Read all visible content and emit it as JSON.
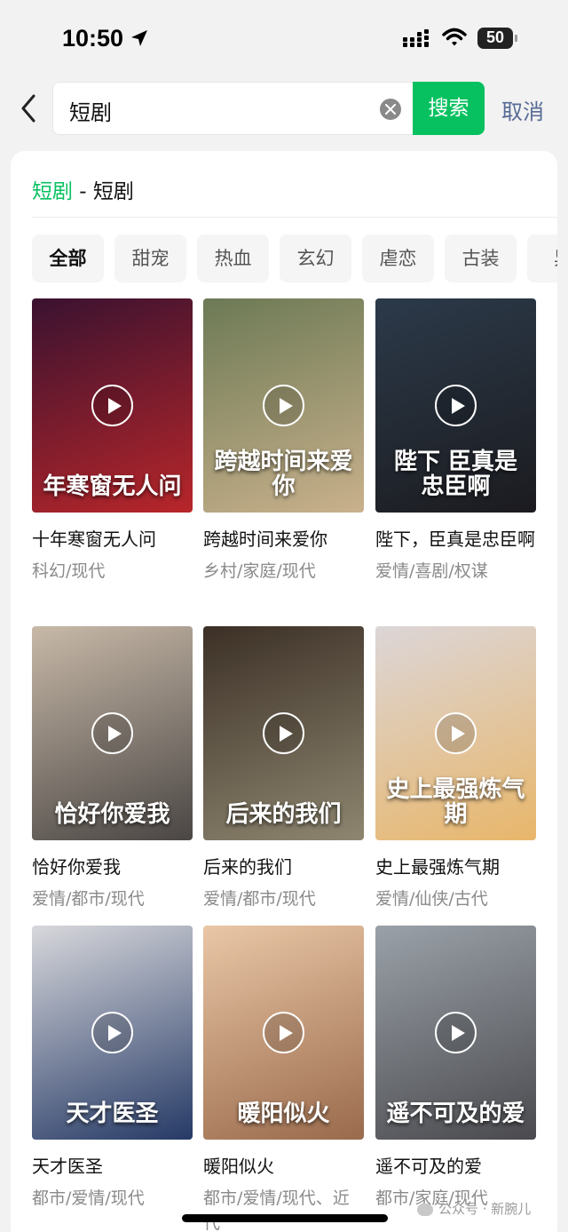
{
  "status_bar": {
    "time": "10:50",
    "battery": "50"
  },
  "search": {
    "query": "短剧",
    "button_label": "搜索",
    "cancel_label": "取消"
  },
  "result_header": {
    "highlight": "短剧",
    "rest": " - 短剧"
  },
  "tabs": [
    {
      "label": "全部",
      "active": true
    },
    {
      "label": "甜宠"
    },
    {
      "label": "热血"
    },
    {
      "label": "玄幻"
    },
    {
      "label": "虐恋"
    },
    {
      "label": "古装"
    },
    {
      "label": "异"
    }
  ],
  "dramas": [
    {
      "title": "十年寒窗无人问",
      "tags": "科幻/现代",
      "poster_text": "年寒窗无人问",
      "colors": [
        "#3a1230",
        "#b8262a"
      ]
    },
    {
      "title": "跨越时间来爱你",
      "tags": "乡村/家庭/现代",
      "poster_text": "跨越时间来爱你",
      "colors": [
        "#6c7a55",
        "#c9b18c"
      ]
    },
    {
      "title": "陛下，臣真是忠臣啊",
      "tags": "爱情/喜剧/权谋",
      "poster_text": "陛下 臣真是忠臣啊",
      "colors": [
        "#2c3a4a",
        "#1b1b1f"
      ]
    },
    {
      "title": "恰好你爱我",
      "tags": "爱情/都市/现代",
      "poster_text": "恰好你爱我",
      "colors": [
        "#c8b9a8",
        "#4a4644"
      ]
    },
    {
      "title": "后来的我们",
      "tags": "爱情/都市/现代",
      "poster_text": "后来的我们",
      "colors": [
        "#3c3026",
        "#8e8670"
      ]
    },
    {
      "title": "史上最强炼气期",
      "tags": "爱情/仙侠/古代",
      "poster_text": "史上最强炼气期",
      "colors": [
        "#dcd6d8",
        "#e8b66a"
      ]
    },
    {
      "title": "天才医圣",
      "tags": "都市/爱情/现代",
      "poster_text": "天才医圣",
      "colors": [
        "#d8d8dc",
        "#263a66"
      ]
    },
    {
      "title": "暖阳似火",
      "tags": "都市/爱情/现代、近代",
      "poster_text": "暖阳似火",
      "colors": [
        "#e9c7a6",
        "#9a6a4c"
      ]
    },
    {
      "title": "遥不可及的爱",
      "tags": "都市/家庭/现代",
      "poster_text": "遥不可及的爱",
      "colors": [
        "#9aa1a8",
        "#4a4a4e"
      ]
    }
  ],
  "watermark": "公众号 · 新腕儿"
}
